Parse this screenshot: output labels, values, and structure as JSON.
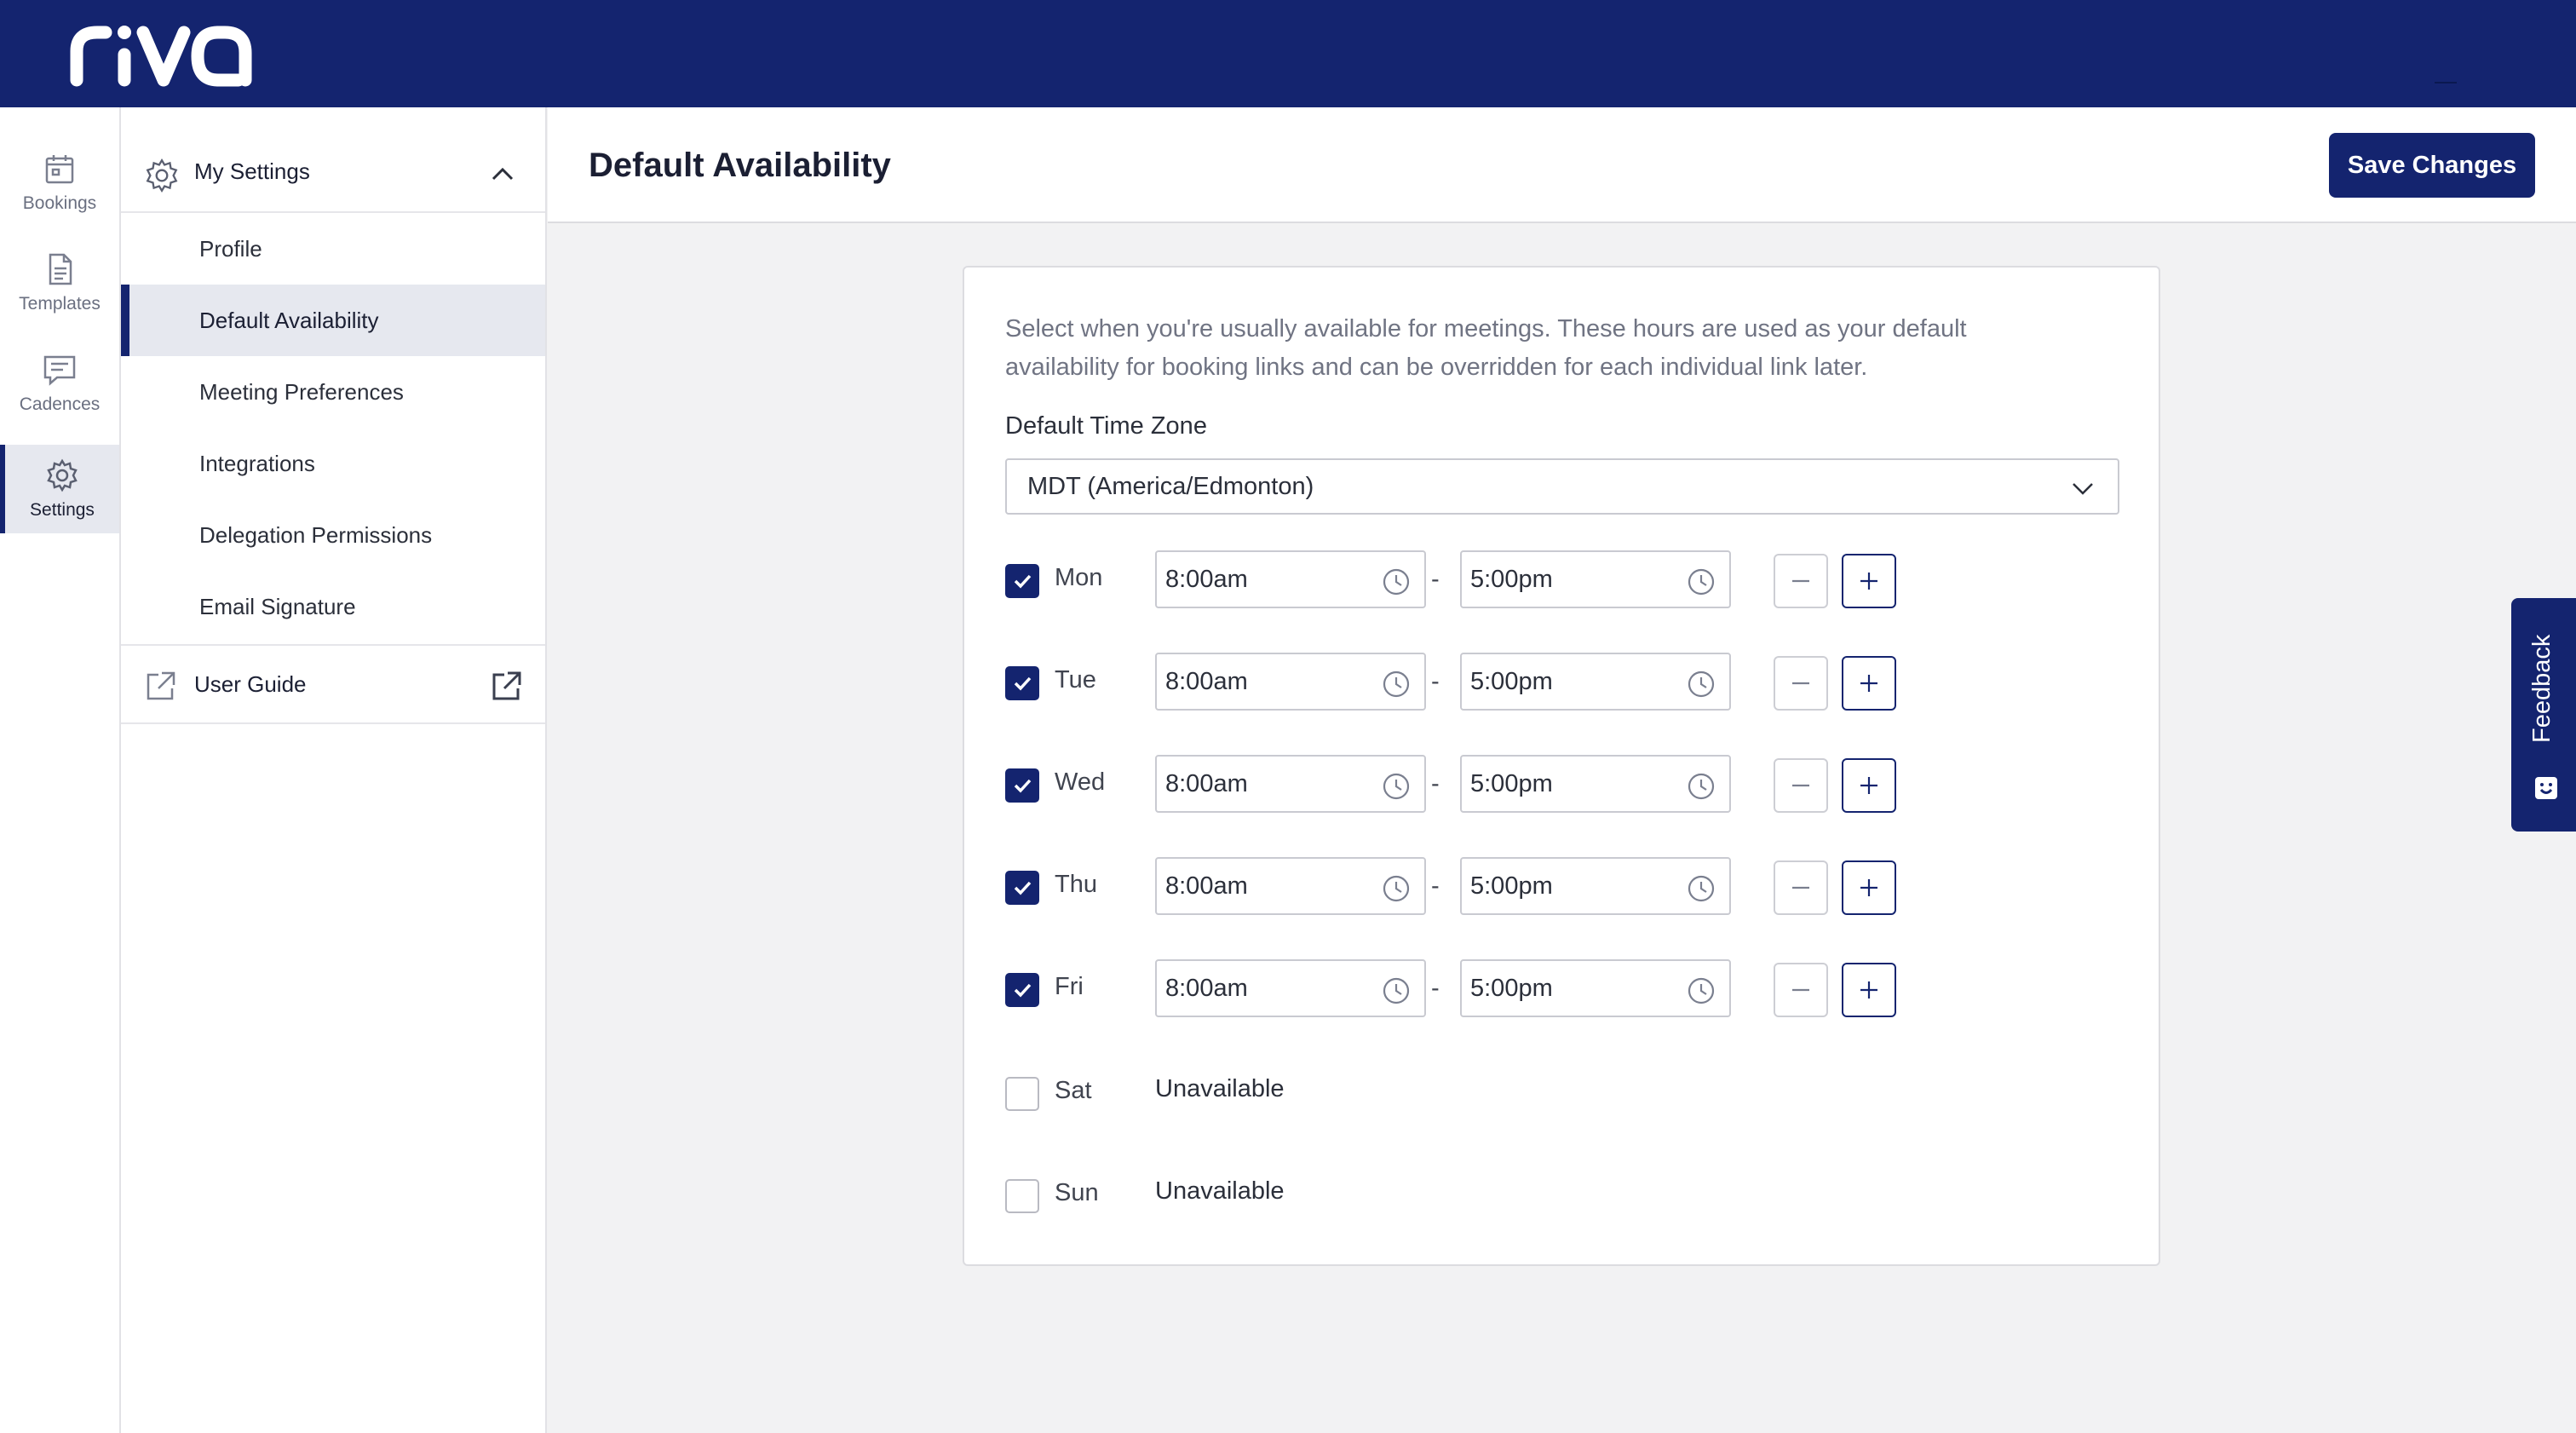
{
  "brand": {
    "name": "riva",
    "primary_color": "#14246f"
  },
  "rail": {
    "items": [
      {
        "label": "Bookings",
        "icon": "calendar-icon"
      },
      {
        "label": "Templates",
        "icon": "document-icon"
      },
      {
        "label": "Cadences",
        "icon": "message-icon"
      },
      {
        "label": "Settings",
        "icon": "gear-icon",
        "active": true
      }
    ]
  },
  "menu": {
    "header": "My Settings",
    "items": [
      {
        "label": "Profile"
      },
      {
        "label": "Default Availability",
        "active": true
      },
      {
        "label": "Meeting Preferences"
      },
      {
        "label": "Integrations"
      },
      {
        "label": "Delegation Permissions"
      },
      {
        "label": "Email Signature"
      }
    ],
    "user_guide": "User Guide"
  },
  "page": {
    "title": "Default Availability",
    "save_label": "Save Changes"
  },
  "availability": {
    "intro": "Select when you're usually available for meetings. These hours are used as your default availability for booking links and can be overridden for each individual link later.",
    "timezone_label": "Default Time Zone",
    "timezone_value": "MDT (America/Edmonton)",
    "separator": "-",
    "unavailable_text": "Unavailable",
    "days": [
      {
        "label": "Mon",
        "checked": true,
        "start": "8:00am",
        "end": "5:00pm"
      },
      {
        "label": "Tue",
        "checked": true,
        "start": "8:00am",
        "end": "5:00pm"
      },
      {
        "label": "Wed",
        "checked": true,
        "start": "8:00am",
        "end": "5:00pm"
      },
      {
        "label": "Thu",
        "checked": true,
        "start": "8:00am",
        "end": "5:00pm"
      },
      {
        "label": "Fri",
        "checked": true,
        "start": "8:00am",
        "end": "5:00pm"
      },
      {
        "label": "Sat",
        "checked": false,
        "status": "Unavailable"
      },
      {
        "label": "Sun",
        "checked": false,
        "status": "Unavailable"
      }
    ]
  },
  "feedback": {
    "label": "Feedback"
  }
}
